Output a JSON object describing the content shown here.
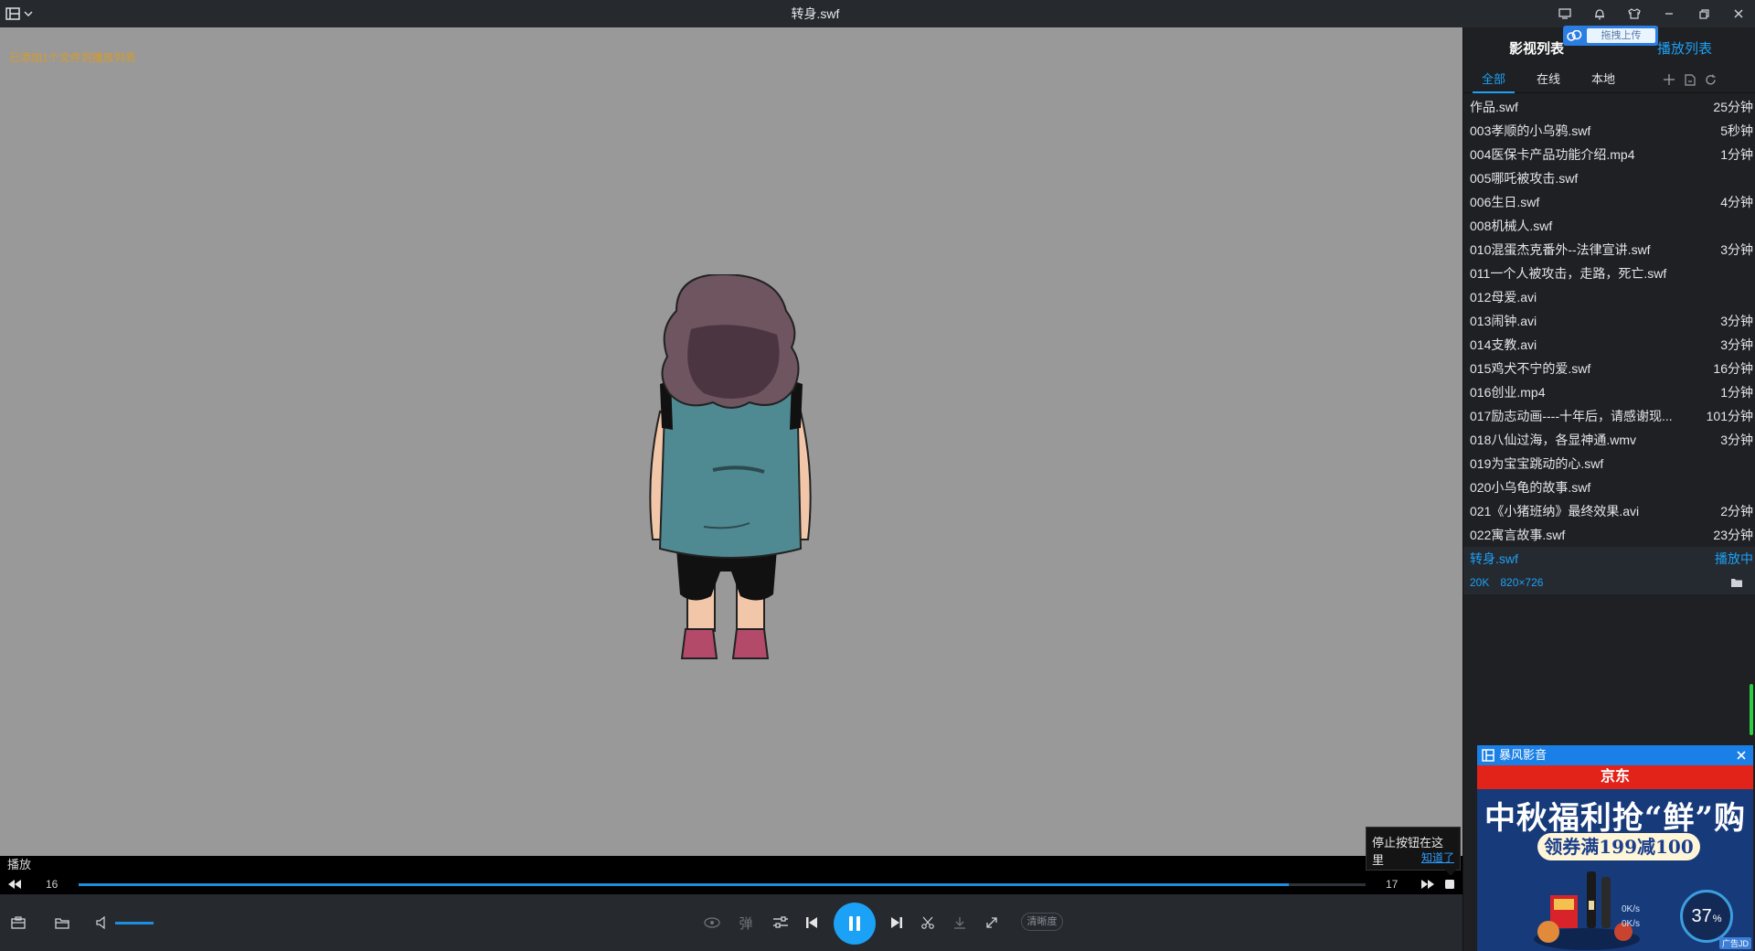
{
  "window": {
    "title": "转身.swf"
  },
  "video": {
    "hint": "已添加1个文件到播放列表"
  },
  "status": {
    "text": "播放"
  },
  "progress": {
    "elapsed": "16",
    "remaining": "17",
    "fraction": 0.94
  },
  "tooltip": {
    "text": "停止按钮在这里",
    "ok": "知道了"
  },
  "controls": {
    "danmaku_label": "弹",
    "quality_label": "清晰度",
    "volume_level": 0.75,
    "icons": [
      "toolbox-icon",
      "open-folder-icon",
      "volume-icon",
      "3d-icon",
      "danmaku-icon",
      "settings-sliders-icon",
      "previous-icon",
      "pause-icon",
      "next-icon",
      "cut-icon",
      "download-icon",
      "fullscreen-icon"
    ]
  },
  "panel": {
    "title_left": "影视列表",
    "title_right": "播放列表",
    "upload_label": "拖拽上传",
    "tabs": [
      {
        "label": "全部",
        "active": true
      },
      {
        "label": "在线",
        "active": false
      },
      {
        "label": "本地",
        "active": false
      }
    ],
    "items": [
      {
        "name": "作品.swf",
        "duration": "25分钟"
      },
      {
        "name": "003孝顺的小乌鸦.swf",
        "duration": "5秒钟"
      },
      {
        "name": "004医保卡产品功能介绍.mp4",
        "duration": "1分钟"
      },
      {
        "name": "005哪吒被攻击.swf",
        "duration": ""
      },
      {
        "name": "006生日.swf",
        "duration": "4分钟"
      },
      {
        "name": "008机械人.swf",
        "duration": ""
      },
      {
        "name": "010混蛋杰克番外--法律宣讲.swf",
        "duration": "3分钟"
      },
      {
        "name": "011一个人被攻击，走路，死亡.swf",
        "duration": ""
      },
      {
        "name": "012母爱.avi",
        "duration": ""
      },
      {
        "name": "013闹钟.avi",
        "duration": "3分钟"
      },
      {
        "name": "014支教.avi",
        "duration": "3分钟"
      },
      {
        "name": "015鸡犬不宁的爱.swf",
        "duration": "16分钟"
      },
      {
        "name": "016创业.mp4",
        "duration": "1分钟"
      },
      {
        "name": "017励志动画----十年后，请感谢现...",
        "duration": "101分钟"
      },
      {
        "name": "018八仙过海，各显神通.wmv",
        "duration": "3分钟"
      },
      {
        "name": "019为宝宝跳动的心.swf",
        "duration": ""
      },
      {
        "name": "020小乌龟的故事.swf",
        "duration": ""
      },
      {
        "name": "021《小猪班纳》最终效果.avi",
        "duration": "2分钟"
      },
      {
        "name": "022寓言故事.swf",
        "duration": "23分钟"
      }
    ],
    "current": {
      "name": "转身.swf",
      "status": "播放中",
      "size": "20K",
      "resolution": "820×726"
    }
  },
  "ad": {
    "app_name": "暴风影音",
    "brand": "京东",
    "headline": "中秋福利抢“鲜”购",
    "coupon": "领券满199减100",
    "gauge_value": "37",
    "gauge_unit": "%",
    "speed_up": "0K/s",
    "speed_down": "0K/s",
    "label": "广告JD"
  }
}
